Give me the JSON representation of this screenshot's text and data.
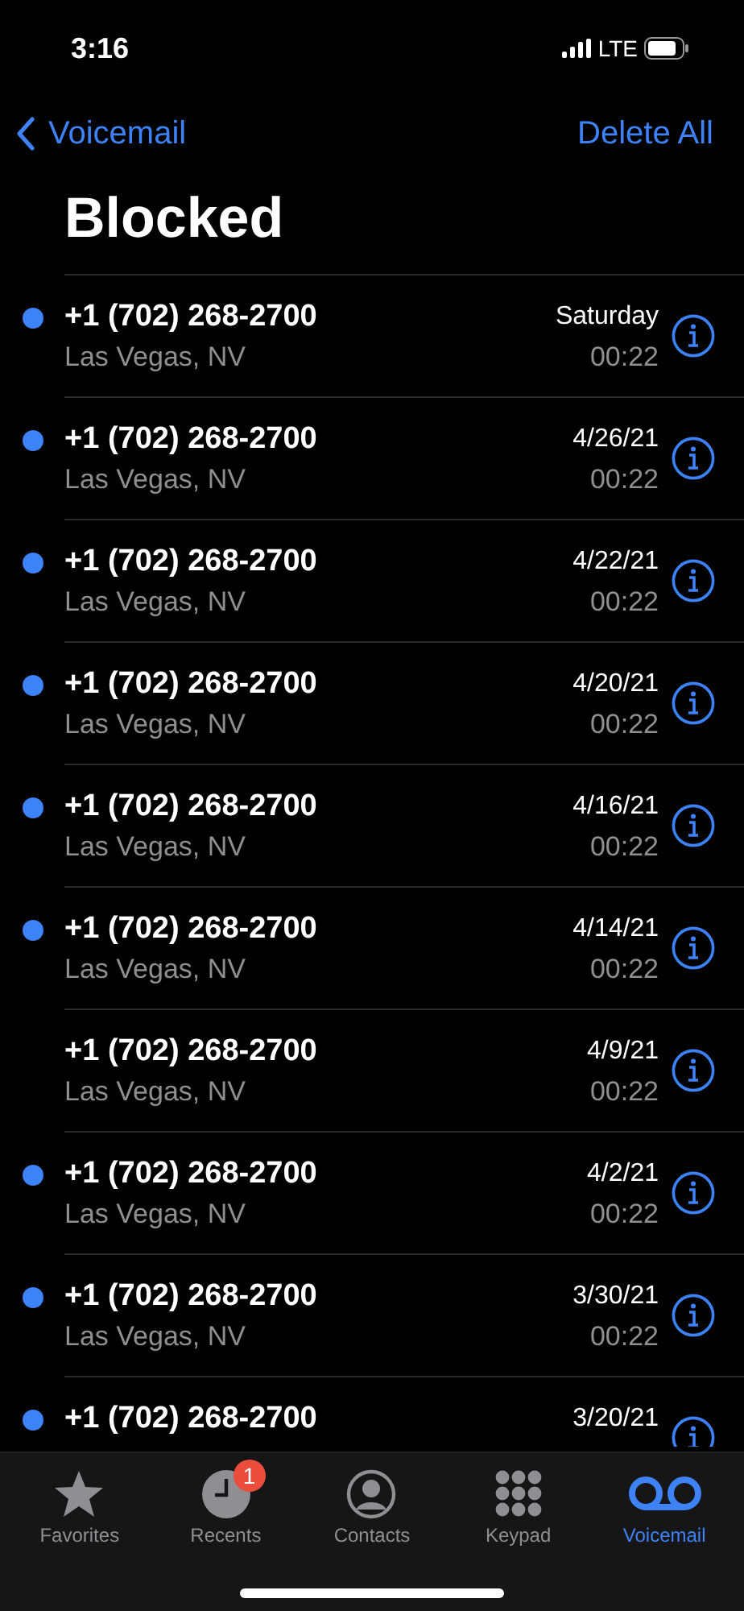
{
  "status_bar": {
    "time": "3:16",
    "network": "LTE"
  },
  "nav": {
    "back": "Voicemail",
    "action": "Delete All"
  },
  "title": "Blocked",
  "rows": [
    {
      "number": "+1 (702) 268-2700",
      "location": "Las Vegas, NV",
      "date": "Saturday",
      "duration": "00:22",
      "unread": true
    },
    {
      "number": "+1 (702) 268-2700",
      "location": "Las Vegas, NV",
      "date": "4/26/21",
      "duration": "00:22",
      "unread": true
    },
    {
      "number": "+1 (702) 268-2700",
      "location": "Las Vegas, NV",
      "date": "4/22/21",
      "duration": "00:22",
      "unread": true
    },
    {
      "number": "+1 (702) 268-2700",
      "location": "Las Vegas, NV",
      "date": "4/20/21",
      "duration": "00:22",
      "unread": true
    },
    {
      "number": "+1 (702) 268-2700",
      "location": "Las Vegas, NV",
      "date": "4/16/21",
      "duration": "00:22",
      "unread": true
    },
    {
      "number": "+1 (702) 268-2700",
      "location": "Las Vegas, NV",
      "date": "4/14/21",
      "duration": "00:22",
      "unread": true
    },
    {
      "number": "+1 (702) 268-2700",
      "location": "Las Vegas, NV",
      "date": "4/9/21",
      "duration": "00:22",
      "unread": false
    },
    {
      "number": "+1 (702) 268-2700",
      "location": "Las Vegas, NV",
      "date": "4/2/21",
      "duration": "00:22",
      "unread": true
    },
    {
      "number": "+1 (702) 268-2700",
      "location": "Las Vegas, NV",
      "date": "3/30/21",
      "duration": "00:22",
      "unread": true
    },
    {
      "number": "+1 (702) 268-2700",
      "date": "3/20/21",
      "unread": true
    }
  ],
  "tabs": [
    {
      "kind": "star",
      "label": "Favorites",
      "selected": false
    },
    {
      "kind": "clock",
      "label": "Recents",
      "selected": false,
      "badge": "1"
    },
    {
      "kind": "person",
      "label": "Contacts",
      "selected": false
    },
    {
      "kind": "keypad",
      "label": "Keypad",
      "selected": false
    },
    {
      "kind": "voicemail",
      "label": "Voicemail",
      "selected": true
    }
  ]
}
